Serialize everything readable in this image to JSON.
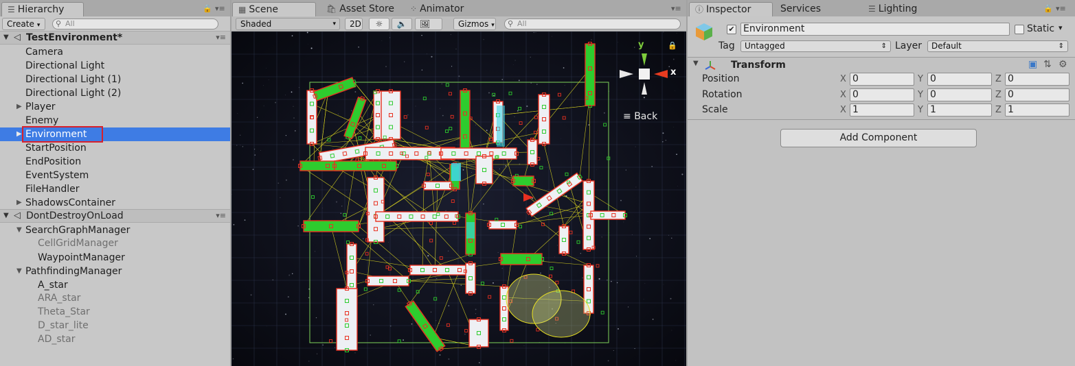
{
  "hierarchy": {
    "tab_label": "Hierarchy",
    "create_label": "Create",
    "search_placeholder": "All",
    "scene1": {
      "name": "TestEnvironment*",
      "items": [
        {
          "label": "Camera"
        },
        {
          "label": "Directional Light"
        },
        {
          "label": "Directional Light (1)"
        },
        {
          "label": "Directional Light (2)"
        },
        {
          "label": "Player"
        },
        {
          "label": "Enemy"
        },
        {
          "label": "Environment"
        },
        {
          "label": "StartPosition"
        },
        {
          "label": "EndPosition"
        },
        {
          "label": "EventSystem"
        },
        {
          "label": "FileHandler"
        },
        {
          "label": "ShadowsContainer"
        }
      ]
    },
    "scene2": {
      "name": "DontDestroyOnLoad",
      "items": [
        {
          "label": "SearchGraphManager"
        },
        {
          "label": "CellGridManager"
        },
        {
          "label": "WaypointManager"
        },
        {
          "label": "PathfindingManager"
        },
        {
          "label": "A_star"
        },
        {
          "label": "ARA_star"
        },
        {
          "label": "Theta_Star"
        },
        {
          "label": "D_star_lite"
        },
        {
          "label": "AD_star"
        }
      ]
    }
  },
  "scene_view": {
    "tabs": {
      "scene": "Scene",
      "asset_store": "Asset Store",
      "animator": "Animator"
    },
    "shading_mode": "Shaded",
    "mode_2d": "2D",
    "gizmos_label": "Gizmos",
    "search_placeholder": "All",
    "gizmo": {
      "y_label": "y",
      "x_label": "x",
      "back_label": "Back"
    }
  },
  "inspector": {
    "tabs": {
      "inspector": "Inspector",
      "services": "Services",
      "lighting": "Lighting"
    },
    "object_name": "Environment",
    "active_checked": true,
    "static_label": "Static",
    "tag_label": "Tag",
    "tag_value": "Untagged",
    "layer_label": "Layer",
    "layer_value": "Default",
    "transform": {
      "title": "Transform",
      "rows": [
        {
          "label": "Position",
          "x": "0",
          "y": "0",
          "z": "0"
        },
        {
          "label": "Rotation",
          "x": "0",
          "y": "0",
          "z": "0"
        },
        {
          "label": "Scale",
          "x": "1",
          "y": "1",
          "z": "1"
        }
      ]
    },
    "add_component_label": "Add Component"
  },
  "colors": {
    "selection": "#3e7ce4",
    "highlight_box": "#d8202a",
    "node_green": "#2ecc2e",
    "node_red": "#e83020",
    "edge_yellow": "#e8e020"
  }
}
